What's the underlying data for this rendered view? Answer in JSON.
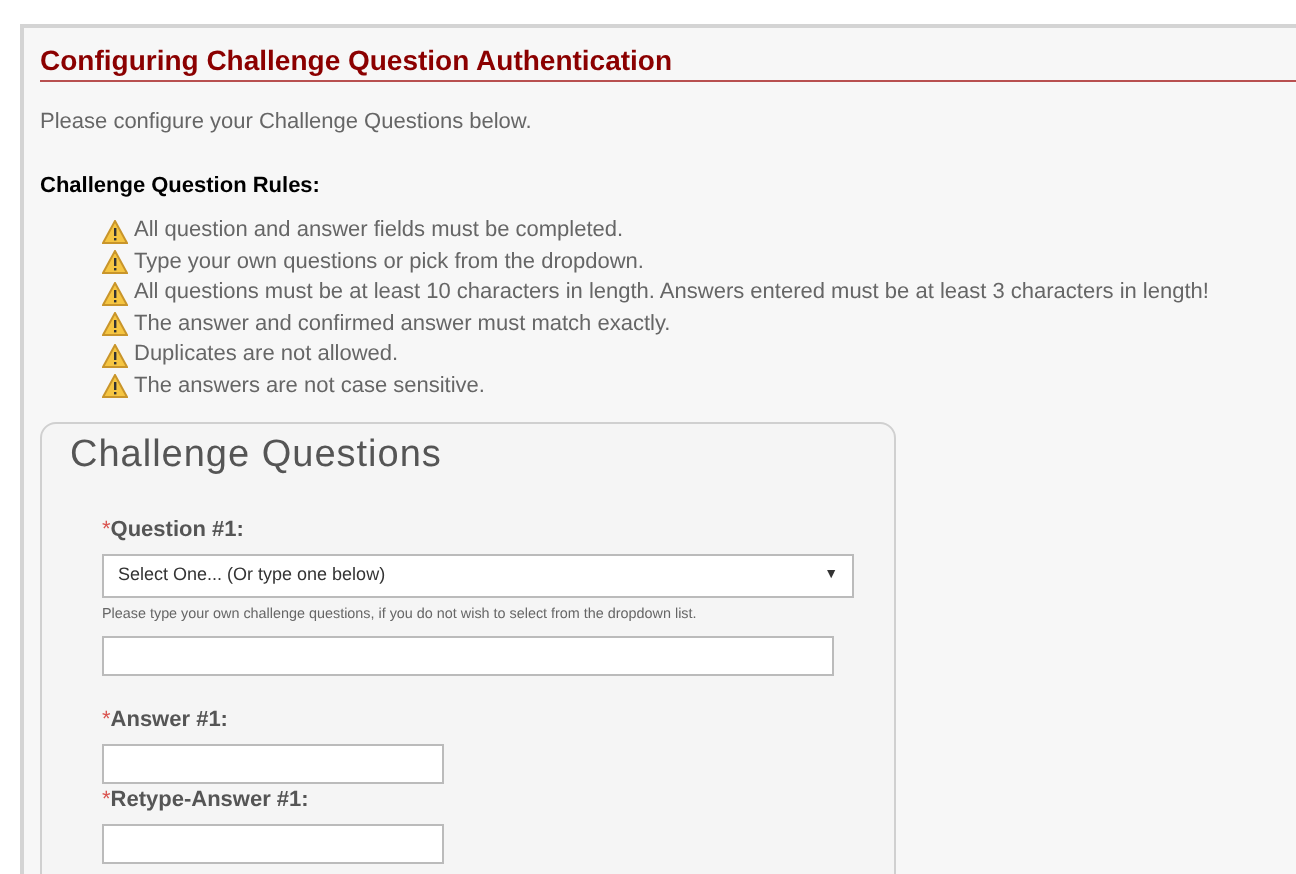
{
  "title": "Configuring Challenge Question Authentication",
  "intro": "Please configure your Challenge Questions below.",
  "rules_heading": "Challenge Question Rules:",
  "rules": [
    "All question and answer fields must be completed.",
    "Type your own questions or pick from the dropdown.",
    "All questions must be at least 10 characters in length. Answers entered must be at least 3 characters in length!",
    "The answer and confirmed answer must match exactly.",
    "Duplicates are not allowed.",
    "The answers are not case sensitive."
  ],
  "card": {
    "heading": "Challenge Questions",
    "fields": [
      {
        "kind": "select",
        "required_mark": "*",
        "label": "Question #1:",
        "value": "Select One... (Or type one below)",
        "caret": "▼"
      },
      {
        "kind": "hint",
        "text": "Please type your own challenge questions, if you do not wish to select from the dropdown list."
      },
      {
        "kind": "wide-input"
      },
      {
        "kind": "short-input",
        "required_mark": "*",
        "label": "Answer #1:"
      },
      {
        "kind": "short-input",
        "required_mark": "*",
        "label": "Retype-Answer #1:"
      }
    ]
  }
}
